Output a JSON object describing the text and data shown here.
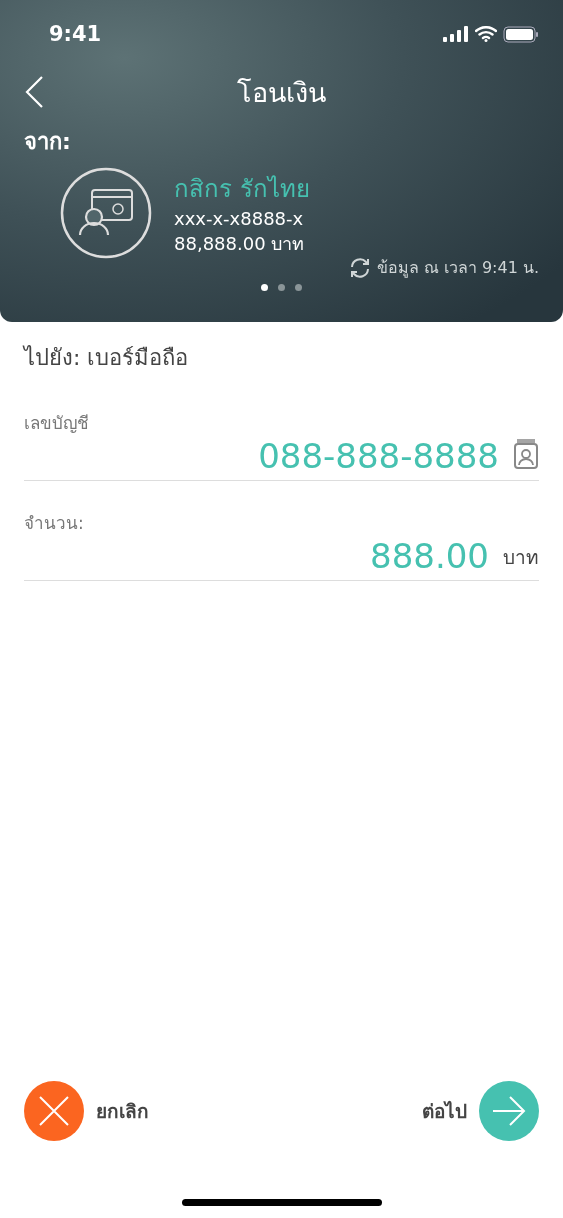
{
  "status_bar": {
    "time": "9:41"
  },
  "header": {
    "title": "โอนเงิน",
    "from_label": "จาก:",
    "account": {
      "bank": "กสิกร รักไทย",
      "number": "xxx-x-x8888-x",
      "balance": "88,888.00 บาท"
    },
    "updated": "ข้อมูล ณ เวลา 9:41 น.",
    "pages": [
      {
        "selected": true
      },
      {
        "selected": false
      },
      {
        "selected": false
      }
    ]
  },
  "to_label": "ไปยัง: เบอร์มือถือ",
  "fields": [
    {
      "label": "เลขบัญชี",
      "value": "088-888-8888",
      "kind": "contact"
    },
    {
      "label": "จำนวน:",
      "value": "888.00",
      "unit": "บาท",
      "kind": "amount"
    }
  ],
  "actions": {
    "cancel": "ยกเลิก",
    "next": "ต่อไป"
  }
}
